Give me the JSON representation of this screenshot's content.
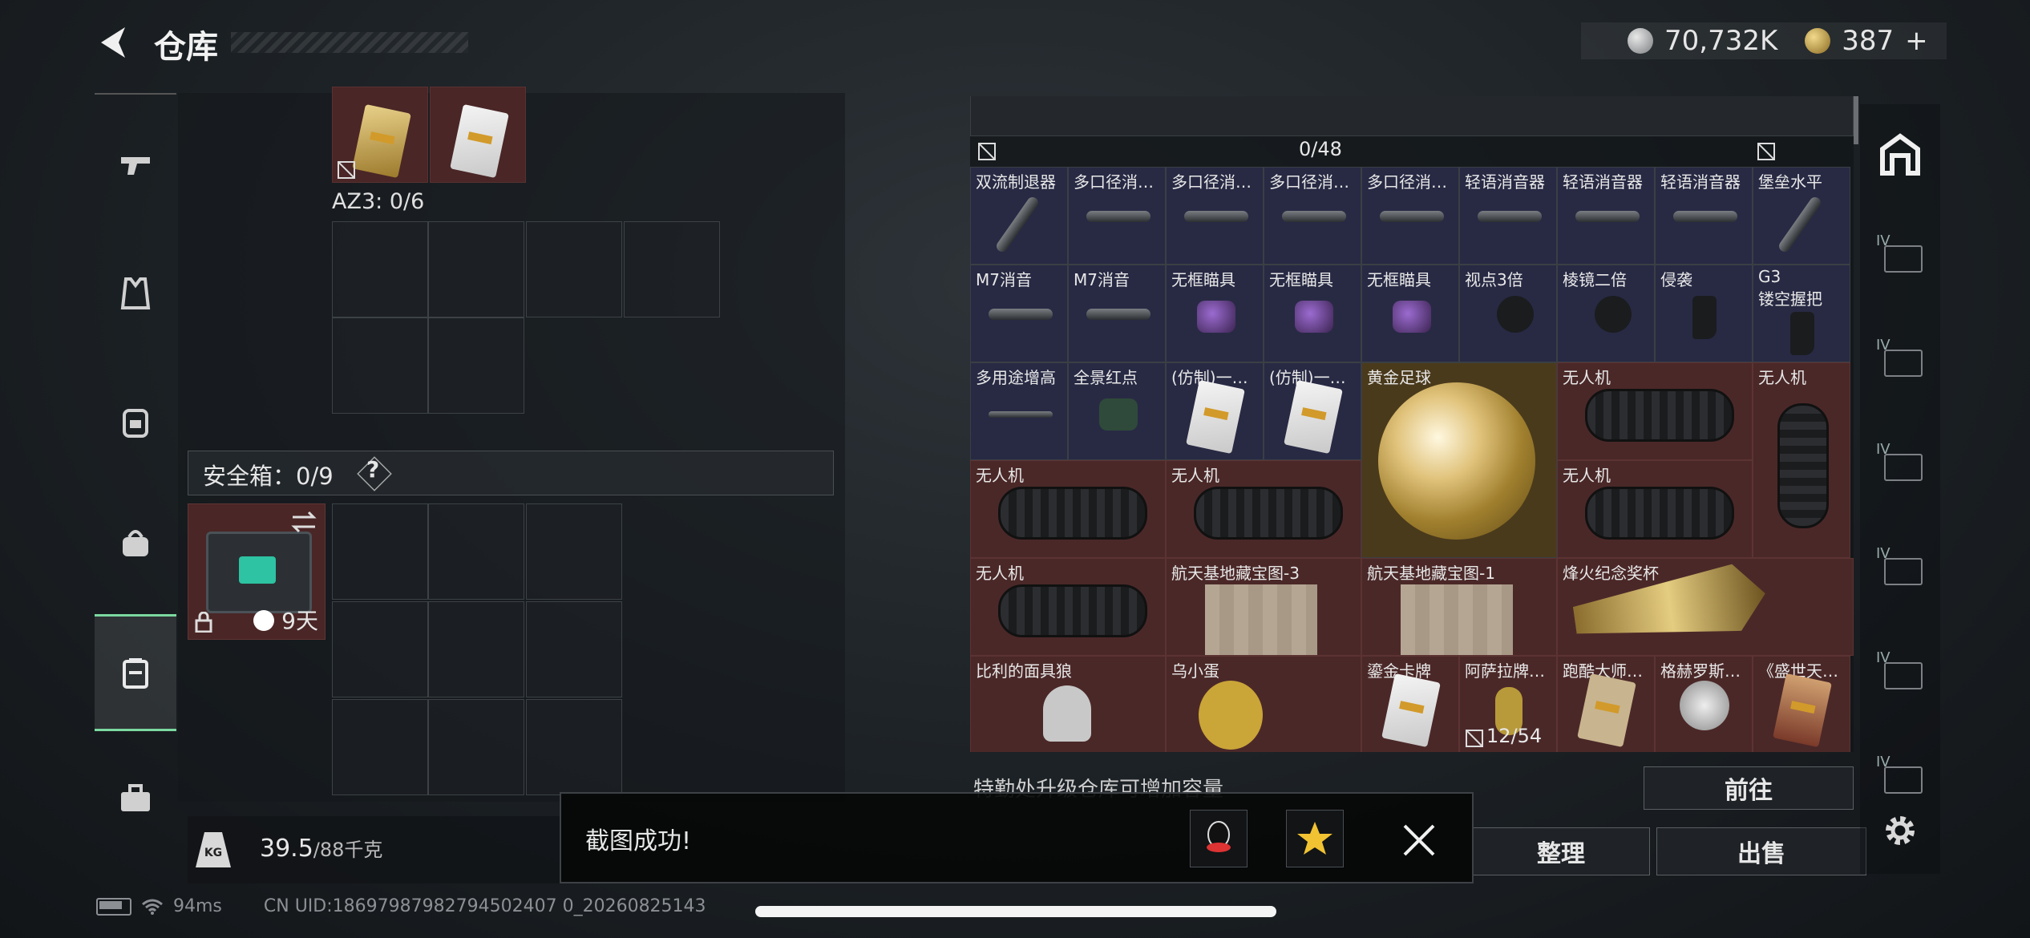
{
  "header": {
    "title": "仓库",
    "silver_amount": "70,732K",
    "gold_amount": "387",
    "gold_plus": "+"
  },
  "left_rail": {
    "items": [
      "weapon-icon",
      "armor-vest-icon",
      "backpack-icon",
      "bag-icon",
      "safebox-icon",
      "toolbox-icon"
    ],
    "active_index": 4
  },
  "left_panel": {
    "az3_label": "AZ3: 0/6",
    "safebox_label": "安全箱：0/9",
    "safebox_help": "?",
    "safebox_days": "9天",
    "weight_value": "39.5",
    "weight_unit": "/88千克"
  },
  "storage": {
    "top_count": "0/48",
    "bottom_count": "12/54",
    "rows": [
      [
        "双流制退器",
        "多口径消…",
        "多口径消…",
        "多口径消…",
        "多口径消…",
        "轻语消音器",
        "轻语消音器",
        "轻语消音器",
        "堡垒水平"
      ],
      [
        "M7消音",
        "M7消音",
        "无框瞄具",
        "无框瞄具",
        "无框瞄具",
        "视点3倍",
        "棱镜二倍",
        "侵袭",
        "G3",
        "镂空握把"
      ],
      [
        "多用途增高",
        "全景红点",
        "(仿制)一…",
        "(仿制)一…",
        "黄金足球",
        "无人机",
        "无人机"
      ],
      [
        "无人机",
        "无人机",
        "无人机"
      ],
      [
        "无人机",
        "航天基地藏宝图-3",
        "航天基地藏宝图-1",
        "烽火纪念奖杯"
      ],
      [
        "比利的面具狼",
        "乌小蛋",
        "鎏金卡牌",
        "阿萨拉牌…",
        "跑酷大师…",
        "格赫罗斯…",
        "《盛世天…"
      ]
    ]
  },
  "upgrade_hint": "特勤处升级仓库可增加容量",
  "buttons": {
    "goto": "前往",
    "sort": "整理",
    "sell": "出售"
  },
  "toast": {
    "text": "截图成功!"
  },
  "status": {
    "ping": "94ms",
    "uid": "CN UID:18697987982794502407 0_20260825143"
  }
}
